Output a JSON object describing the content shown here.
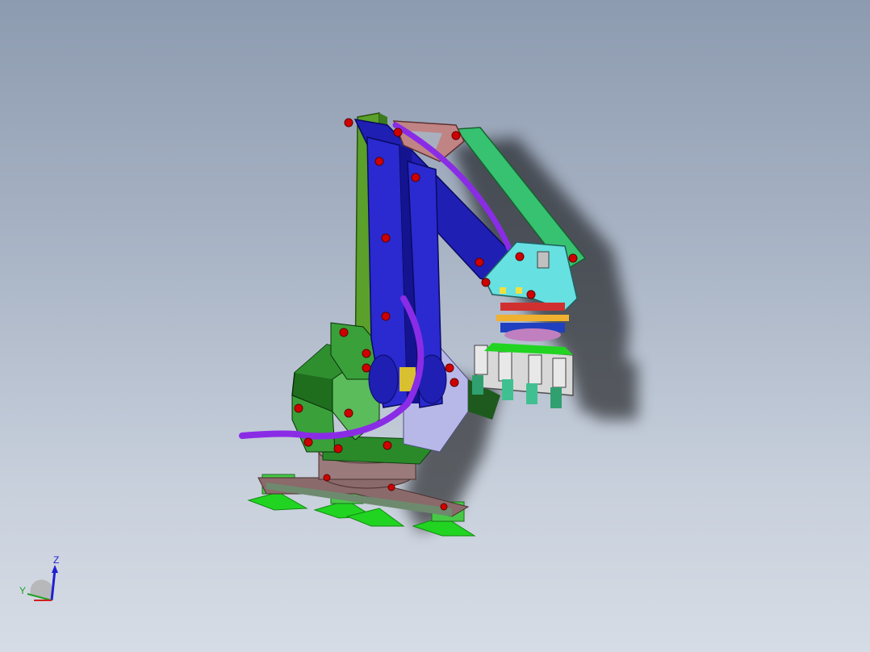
{
  "viewport": {
    "background_top": "#8d9bb0",
    "background_bottom": "#d6dce5"
  },
  "model": {
    "colors": {
      "base_arm": "#2f9a2f",
      "main_link": "#1f1fb4",
      "upper_link": "#36c270",
      "rocker": "#c08484",
      "wrist": "#66e0e0",
      "cable": "#8a2ce6",
      "bolts": "#d00000",
      "gripper_body": "#d8d8d8",
      "suction_cups": "#21d421",
      "base_plate": "#8a6a6a",
      "motor_box": "#1e6e1e"
    }
  },
  "triad": {
    "z_label": "Z",
    "y_label": "Y",
    "z_color": "#2020d0",
    "y_color": "#20a020",
    "x_color": "#d02020"
  }
}
